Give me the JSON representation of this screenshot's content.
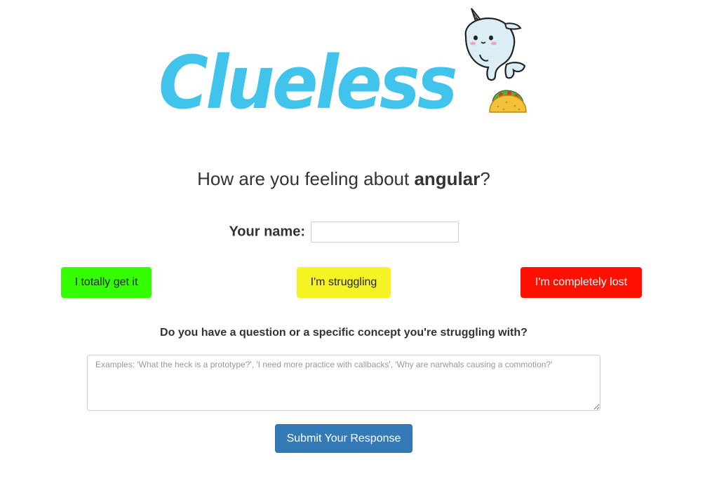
{
  "header": {
    "logo_text": "Clueless",
    "mascot_icon": "narwhal-icon",
    "food_icon": "taco-icon",
    "brand_color": "#41c4ec"
  },
  "main": {
    "heading_prefix": "How are you feeling about ",
    "heading_topic": "angular",
    "heading_suffix": "?",
    "name_label": "Your name:",
    "name_value": "",
    "feelings": [
      {
        "label": "I totally get it",
        "color": "#33ff00"
      },
      {
        "label": "I'm struggling",
        "color": "#f6f324"
      },
      {
        "label": "I'm completely lost",
        "color": "#ff1000"
      }
    ],
    "concept_label": "Do you have a question or a specific concept you're struggling with?",
    "concept_placeholder": "Examples: 'What the heck is a prototype?', 'I need more practice with callbacks', 'Why are narwhals causing a commotion?'",
    "submit_label": "Submit Your Response",
    "submit_color": "#337ab7"
  }
}
